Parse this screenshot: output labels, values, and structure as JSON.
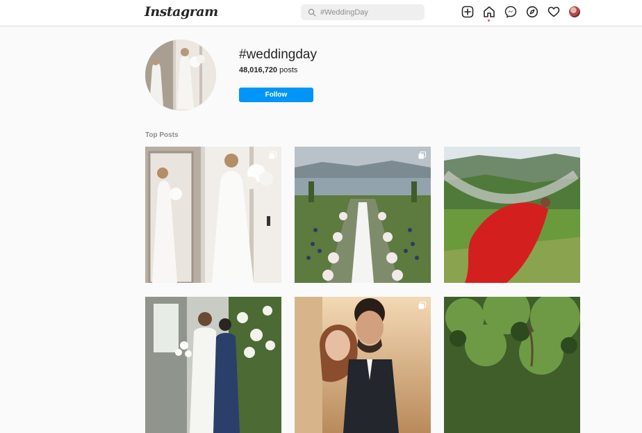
{
  "app": {
    "logo": "Instagram"
  },
  "search": {
    "placeholder": "#WeddingDay"
  },
  "nav": {
    "icons": [
      "new-post-icon",
      "home-icon",
      "messenger-icon",
      "explore-icon",
      "activity-heart-icon",
      "profile-avatar"
    ],
    "home_notification_color": "#ed4956"
  },
  "hashtag": {
    "name": "#weddingday",
    "posts_count": "48,016,720",
    "posts_label": "posts",
    "follow_label": "Follow"
  },
  "top_posts": {
    "title": "Top Posts",
    "posts": [
      {
        "subject": "bride in white dress at mirror",
        "multi": true
      },
      {
        "subject": "outdoor ceremony aisle with flowers by the lake",
        "multi": true
      },
      {
        "subject": "woman in red dress on hammock",
        "multi": false
      },
      {
        "subject": "bride and woman in blue by flower wall",
        "multi": false
      },
      {
        "subject": "couple smiling at sunset",
        "multi": true
      },
      {
        "subject": "green trees in garden",
        "multi": false
      }
    ]
  },
  "colors": {
    "accent": "#0095f6",
    "border": "#dbdbdb",
    "background": "#fafafa"
  }
}
